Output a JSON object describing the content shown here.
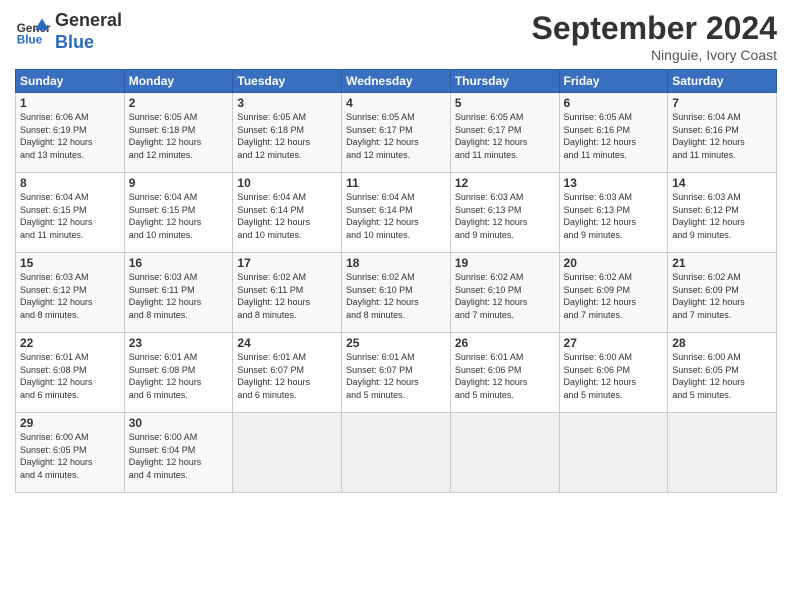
{
  "header": {
    "logo_line1": "General",
    "logo_line2": "Blue",
    "month": "September 2024",
    "location": "Ninguie, Ivory Coast"
  },
  "days_of_week": [
    "Sunday",
    "Monday",
    "Tuesday",
    "Wednesday",
    "Thursday",
    "Friday",
    "Saturday"
  ],
  "weeks": [
    [
      {
        "day": "1",
        "info": "Sunrise: 6:06 AM\nSunset: 6:19 PM\nDaylight: 12 hours\nand 13 minutes."
      },
      {
        "day": "2",
        "info": "Sunrise: 6:05 AM\nSunset: 6:18 PM\nDaylight: 12 hours\nand 12 minutes."
      },
      {
        "day": "3",
        "info": "Sunrise: 6:05 AM\nSunset: 6:18 PM\nDaylight: 12 hours\nand 12 minutes."
      },
      {
        "day": "4",
        "info": "Sunrise: 6:05 AM\nSunset: 6:17 PM\nDaylight: 12 hours\nand 12 minutes."
      },
      {
        "day": "5",
        "info": "Sunrise: 6:05 AM\nSunset: 6:17 PM\nDaylight: 12 hours\nand 11 minutes."
      },
      {
        "day": "6",
        "info": "Sunrise: 6:05 AM\nSunset: 6:16 PM\nDaylight: 12 hours\nand 11 minutes."
      },
      {
        "day": "7",
        "info": "Sunrise: 6:04 AM\nSunset: 6:16 PM\nDaylight: 12 hours\nand 11 minutes."
      }
    ],
    [
      {
        "day": "8",
        "info": "Sunrise: 6:04 AM\nSunset: 6:15 PM\nDaylight: 12 hours\nand 11 minutes."
      },
      {
        "day": "9",
        "info": "Sunrise: 6:04 AM\nSunset: 6:15 PM\nDaylight: 12 hours\nand 10 minutes."
      },
      {
        "day": "10",
        "info": "Sunrise: 6:04 AM\nSunset: 6:14 PM\nDaylight: 12 hours\nand 10 minutes."
      },
      {
        "day": "11",
        "info": "Sunrise: 6:04 AM\nSunset: 6:14 PM\nDaylight: 12 hours\nand 10 minutes."
      },
      {
        "day": "12",
        "info": "Sunrise: 6:03 AM\nSunset: 6:13 PM\nDaylight: 12 hours\nand 9 minutes."
      },
      {
        "day": "13",
        "info": "Sunrise: 6:03 AM\nSunset: 6:13 PM\nDaylight: 12 hours\nand 9 minutes."
      },
      {
        "day": "14",
        "info": "Sunrise: 6:03 AM\nSunset: 6:12 PM\nDaylight: 12 hours\nand 9 minutes."
      }
    ],
    [
      {
        "day": "15",
        "info": "Sunrise: 6:03 AM\nSunset: 6:12 PM\nDaylight: 12 hours\nand 8 minutes."
      },
      {
        "day": "16",
        "info": "Sunrise: 6:03 AM\nSunset: 6:11 PM\nDaylight: 12 hours\nand 8 minutes."
      },
      {
        "day": "17",
        "info": "Sunrise: 6:02 AM\nSunset: 6:11 PM\nDaylight: 12 hours\nand 8 minutes."
      },
      {
        "day": "18",
        "info": "Sunrise: 6:02 AM\nSunset: 6:10 PM\nDaylight: 12 hours\nand 8 minutes."
      },
      {
        "day": "19",
        "info": "Sunrise: 6:02 AM\nSunset: 6:10 PM\nDaylight: 12 hours\nand 7 minutes."
      },
      {
        "day": "20",
        "info": "Sunrise: 6:02 AM\nSunset: 6:09 PM\nDaylight: 12 hours\nand 7 minutes."
      },
      {
        "day": "21",
        "info": "Sunrise: 6:02 AM\nSunset: 6:09 PM\nDaylight: 12 hours\nand 7 minutes."
      }
    ],
    [
      {
        "day": "22",
        "info": "Sunrise: 6:01 AM\nSunset: 6:08 PM\nDaylight: 12 hours\nand 6 minutes."
      },
      {
        "day": "23",
        "info": "Sunrise: 6:01 AM\nSunset: 6:08 PM\nDaylight: 12 hours\nand 6 minutes."
      },
      {
        "day": "24",
        "info": "Sunrise: 6:01 AM\nSunset: 6:07 PM\nDaylight: 12 hours\nand 6 minutes."
      },
      {
        "day": "25",
        "info": "Sunrise: 6:01 AM\nSunset: 6:07 PM\nDaylight: 12 hours\nand 5 minutes."
      },
      {
        "day": "26",
        "info": "Sunrise: 6:01 AM\nSunset: 6:06 PM\nDaylight: 12 hours\nand 5 minutes."
      },
      {
        "day": "27",
        "info": "Sunrise: 6:00 AM\nSunset: 6:06 PM\nDaylight: 12 hours\nand 5 minutes."
      },
      {
        "day": "28",
        "info": "Sunrise: 6:00 AM\nSunset: 6:05 PM\nDaylight: 12 hours\nand 5 minutes."
      }
    ],
    [
      {
        "day": "29",
        "info": "Sunrise: 6:00 AM\nSunset: 6:05 PM\nDaylight: 12 hours\nand 4 minutes."
      },
      {
        "day": "30",
        "info": "Sunrise: 6:00 AM\nSunset: 6:04 PM\nDaylight: 12 hours\nand 4 minutes."
      },
      {
        "day": "",
        "info": ""
      },
      {
        "day": "",
        "info": ""
      },
      {
        "day": "",
        "info": ""
      },
      {
        "day": "",
        "info": ""
      },
      {
        "day": "",
        "info": ""
      }
    ]
  ]
}
